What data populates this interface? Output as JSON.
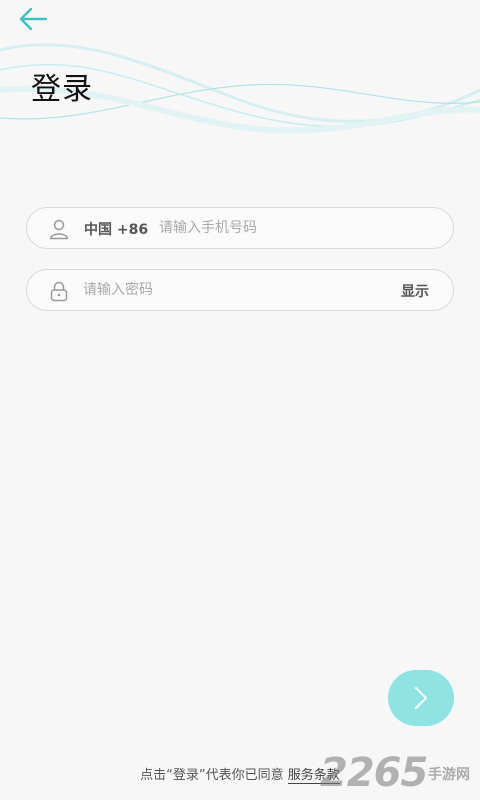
{
  "header": {
    "title": "登录"
  },
  "phone_field": {
    "country_code": "中国 +86",
    "placeholder": "请输入手机号码"
  },
  "password_field": {
    "placeholder": "请输入密码",
    "toggle_label": "显示"
  },
  "footer": {
    "agreement_text": "点击“登录”代表你已同意",
    "terms_link": "服务条款"
  },
  "watermark": {
    "number": "2265",
    "suffix": "手游网"
  },
  "colors": {
    "accent": "#3fc1c1",
    "next_button": "#8fe3e3",
    "background": "#f7f7f7"
  },
  "icons": {
    "back": "arrow-left-icon",
    "user": "user-icon",
    "lock": "lock-icon",
    "next": "chevron-right-icon"
  }
}
